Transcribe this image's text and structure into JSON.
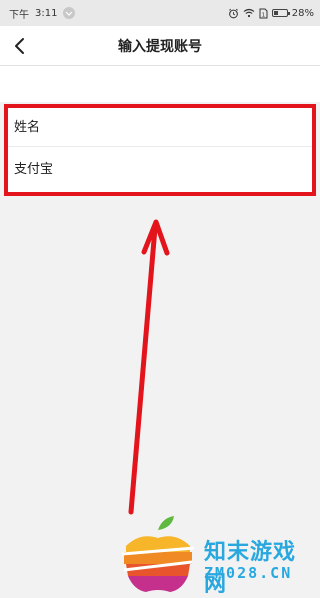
{
  "status_bar": {
    "ampm": "下午",
    "time": "3:11",
    "battery_percent": 28,
    "battery_label": "28%",
    "icons": [
      "alarm-icon",
      "wifi-icon",
      "sim-icon",
      "battery-icon"
    ]
  },
  "header": {
    "title": "输入提现账号",
    "back_icon": "chevron-left-icon"
  },
  "form": {
    "name_label": "姓名",
    "alipay_label": "支付宝"
  },
  "annotation": {
    "color": "#e3141b"
  },
  "watermark": {
    "text_cn": "知末游戏网",
    "text_en": "ZM028.CN",
    "color": "#29a8e0"
  }
}
